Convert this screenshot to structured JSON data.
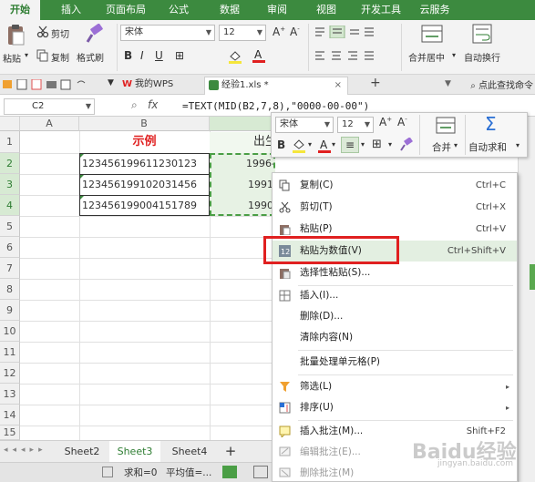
{
  "menu_tabs": [
    "开始",
    "插入",
    "页面布局",
    "公式",
    "数据",
    "审阅",
    "视图",
    "开发工具",
    "云服务"
  ],
  "ribbon": {
    "paste": "粘贴",
    "cut": "剪切",
    "copy": "复制",
    "format_painter": "格式刷",
    "font_name": "宋体",
    "font_size": "12",
    "merge_center": "合并居中",
    "wrap_text": "自动换行"
  },
  "doc_tabs": {
    "mywps": "我的WPS",
    "file": "经验1.xls *",
    "add": "+",
    "find": "点此查找命令"
  },
  "formula_bar": {
    "name_box": "C2",
    "fx": "fx",
    "formula": "=TEXT(MID(B2,7,8),\"0000-00-00\")"
  },
  "columns": [
    "A",
    "B"
  ],
  "rows": [
    "1",
    "2",
    "3",
    "4",
    "5",
    "6",
    "7",
    "8",
    "9",
    "10",
    "11",
    "12",
    "13",
    "14",
    "15"
  ],
  "cells": {
    "b1": "示例",
    "c1": "出生",
    "b2": "123456199611230123",
    "b3": "123456199102031456",
    "b4": "123456199004151789",
    "c2": "1996-11-23",
    "c3": "1991",
    "c4": "1990"
  },
  "sheets": [
    "Sheet2",
    "Sheet3",
    "Sheet4"
  ],
  "add_sheet": "+",
  "status": {
    "sum": "求和=0",
    "avg": "平均值=..."
  },
  "mini_toolbar": {
    "font_name": "宋体",
    "font_size": "12",
    "merge": "合并",
    "autosum": "自动求和",
    "sigma": "Σ"
  },
  "context_menu": [
    {
      "label": "复制(C)",
      "shortcut": "Ctrl+C"
    },
    {
      "label": "剪切(T)",
      "shortcut": "Ctrl+X"
    },
    {
      "label": "粘贴(P)",
      "shortcut": "Ctrl+V"
    },
    {
      "label": "粘贴为数值(V)",
      "shortcut": "Ctrl+Shift+V"
    },
    {
      "label": "选择性粘贴(S)...",
      "shortcut": ""
    },
    {
      "label": "插入(I)...",
      "shortcut": ""
    },
    {
      "label": "删除(D)...",
      "shortcut": ""
    },
    {
      "label": "清除内容(N)",
      "shortcut": ""
    },
    {
      "label": "批量处理单元格(P)",
      "shortcut": ""
    },
    {
      "label": "筛选(L)",
      "shortcut": ""
    },
    {
      "label": "排序(U)",
      "shortcut": ""
    },
    {
      "label": "插入批注(M)...",
      "shortcut": "Shift+F2"
    },
    {
      "label": "编辑批注(E)...",
      "shortcut": ""
    },
    {
      "label": "删除批注(M)",
      "shortcut": ""
    }
  ],
  "watermark": "Baidu经验",
  "watermark_sub": "jingyan.baidu.com",
  "colors": {
    "brand_green": "#3c8a3f",
    "header_red": "#e02020",
    "hover_green": "#e3efe1",
    "selection_green": "#2e7d32"
  }
}
